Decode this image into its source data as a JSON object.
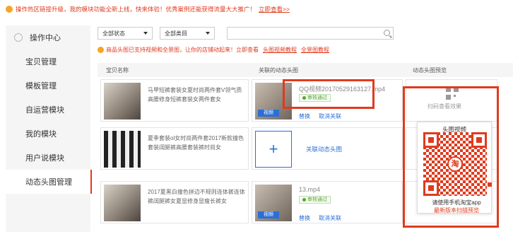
{
  "banner": {
    "text": "操作热区链接升级，我的模块功能全新上线，快来体验！优秀案例还能获得流量大大推广！",
    "link": "立即查看>>"
  },
  "sidebar": {
    "header": "操作中心",
    "items": [
      {
        "label": "宝贝管理"
      },
      {
        "label": "模板管理"
      },
      {
        "label": "自运营模块"
      },
      {
        "label": "我的模块"
      },
      {
        "label": "用户说模块"
      },
      {
        "label": "动态头图管理"
      }
    ]
  },
  "filters": {
    "status": "全部状态",
    "category": "全部类目",
    "search_placeholder": ""
  },
  "notice": {
    "text": "商品头图已支持视频和全景图，让你的店铺动起来！立即查看",
    "link1": "头图视频教程",
    "link2": "全景图教程"
  },
  "columns": {
    "item": "宝贝名称",
    "linked": "关联的动态头图",
    "preview": "动态头图预览"
  },
  "rows": [
    {
      "title": "马甲短裤套装女夏时尚两件套V领气质高腰修身短裤套装女两件套女",
      "file": "QQ视频20170529163127.mp4",
      "status": "审核通过",
      "tag": "视频",
      "replace": "替换",
      "unlink": "取消关联"
    },
    {
      "title": "夏季套装ol女时尚两件套2017新款撞色套装阔腿裤高腰套装裤时尚女",
      "add_label": "关联动态头图"
    },
    {
      "title": "2017夏黑白撞色拼边不规则连体裤连体裤阔腿裤女夏显修身显瘦长裤女",
      "file": "13.mp4",
      "status": "审核通过",
      "tag": "视频",
      "replace": "替换",
      "unlink": "取消关联"
    }
  ],
  "preview": {
    "qr_label": "扫码查看效果"
  },
  "popup": {
    "title": "头图视频",
    "logo": "淘",
    "line1": "请使用手机淘宝app",
    "line2": "最新版本扫描预览"
  },
  "colors": {
    "accent": "#e03a1e",
    "link": "#2b6fd6",
    "ok": "#5aa336"
  }
}
